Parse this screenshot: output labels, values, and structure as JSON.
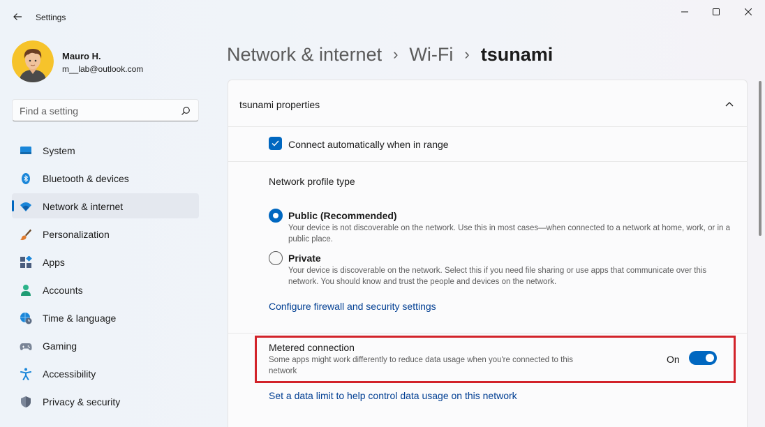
{
  "window": {
    "title": "Settings"
  },
  "user": {
    "name": "Mauro H.",
    "email": "m__lab@outlook.com"
  },
  "search": {
    "placeholder": "Find a setting"
  },
  "nav": {
    "items": [
      {
        "label": "System",
        "icon": "monitor-icon"
      },
      {
        "label": "Bluetooth & devices",
        "icon": "bluetooth-icon"
      },
      {
        "label": "Network & internet",
        "icon": "wifi-icon",
        "selected": true
      },
      {
        "label": "Personalization",
        "icon": "brush-icon"
      },
      {
        "label": "Apps",
        "icon": "apps-icon"
      },
      {
        "label": "Accounts",
        "icon": "person-icon"
      },
      {
        "label": "Time & language",
        "icon": "globe-clock-icon"
      },
      {
        "label": "Gaming",
        "icon": "gamepad-icon"
      },
      {
        "label": "Accessibility",
        "icon": "accessibility-icon"
      },
      {
        "label": "Privacy & security",
        "icon": "shield-icon"
      }
    ]
  },
  "breadcrumb": {
    "level1": "Network & internet",
    "level2": "Wi-Fi",
    "current": "tsunami",
    "separator": "›"
  },
  "card": {
    "title": "tsunami properties",
    "auto_connect_label": "Connect automatically when in range",
    "auto_connect_checked": true,
    "profile_title": "Network profile type",
    "public_label": "Public (Recommended)",
    "public_desc": "Your device is not discoverable on the network. Use this in most cases—when connected to a network at home, work, or in a public place.",
    "private_label": "Private",
    "private_desc": "Your device is discoverable on the network. Select this if you need file sharing or use apps that communicate over this network. You should know and trust the people and devices on the network.",
    "selected_profile": "public",
    "firewall_link": "Configure firewall and security settings",
    "metered_title": "Metered connection",
    "metered_desc": "Some apps might work differently to reduce data usage when you're connected to this network",
    "metered_state": "On",
    "metered_on": true,
    "data_limit_link": "Set a data limit to help control data usage on this network"
  },
  "colors": {
    "accent": "#0067c0",
    "link": "#003e92",
    "highlight": "#d2232a"
  }
}
